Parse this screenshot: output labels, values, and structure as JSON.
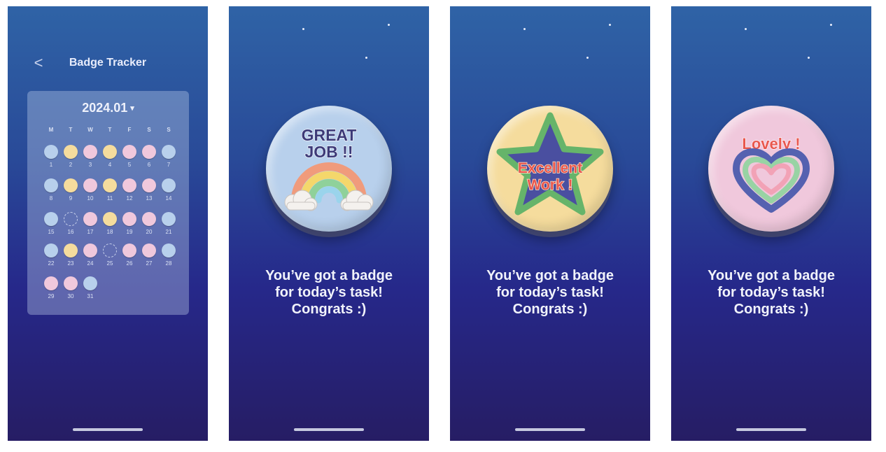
{
  "tracker": {
    "back_label": "<",
    "title": "Badge Tracker",
    "month": "2024.01",
    "month_caret": "▾",
    "weekdays": [
      "M",
      "T",
      "W",
      "T",
      "F",
      "S",
      "S"
    ],
    "days": [
      {
        "day": "1",
        "badge": "great"
      },
      {
        "day": "2",
        "badge": "excellent"
      },
      {
        "day": "3",
        "badge": "lovely"
      },
      {
        "day": "4",
        "badge": "excellent"
      },
      {
        "day": "5",
        "badge": "lovely"
      },
      {
        "day": "6",
        "badge": "lovely"
      },
      {
        "day": "7",
        "badge": "great"
      },
      {
        "day": "8",
        "badge": "great"
      },
      {
        "day": "9",
        "badge": "excellent"
      },
      {
        "day": "10",
        "badge": "lovely"
      },
      {
        "day": "11",
        "badge": "excellent"
      },
      {
        "day": "12",
        "badge": "lovely"
      },
      {
        "day": "13",
        "badge": "lovely"
      },
      {
        "day": "14",
        "badge": "great"
      },
      {
        "day": "15",
        "badge": "great"
      },
      {
        "day": "16",
        "badge": "empty"
      },
      {
        "day": "17",
        "badge": "lovely"
      },
      {
        "day": "18",
        "badge": "excellent"
      },
      {
        "day": "19",
        "badge": "lovely"
      },
      {
        "day": "20",
        "badge": "lovely"
      },
      {
        "day": "21",
        "badge": "great"
      },
      {
        "day": "22",
        "badge": "great"
      },
      {
        "day": "23",
        "badge": "excellent"
      },
      {
        "day": "24",
        "badge": "lovely"
      },
      {
        "day": "25",
        "badge": "empty"
      },
      {
        "day": "26",
        "badge": "lovely"
      },
      {
        "day": "27",
        "badge": "lovely"
      },
      {
        "day": "28",
        "badge": "great"
      },
      {
        "day": "29",
        "badge": "lovely"
      },
      {
        "day": "30",
        "badge": "lovely"
      },
      {
        "day": "31",
        "badge": "great"
      }
    ]
  },
  "screens": [
    {
      "badge_text_1": "GREAT",
      "badge_text_2": "JOB !!",
      "message_1": "You’ve got a badge",
      "message_2": "for today’s task!",
      "message_3": "Congrats :)"
    },
    {
      "badge_text_1": "Excellent",
      "badge_text_2": "Work !",
      "message_1": "You’ve got a badge",
      "message_2": "for today’s task!",
      "message_3": "Congrats :)"
    },
    {
      "badge_text_1": "Lovely !",
      "message_1": "You’ve got a badge",
      "message_2": "for today’s task!",
      "message_3": "Congrats :)"
    }
  ],
  "colors": {
    "great": "#b8d0ec",
    "excellent": "#f5dc9d",
    "lovely": "#f0c8dc",
    "text_dark": "#3d3a78",
    "text_red": "#e9574e"
  }
}
